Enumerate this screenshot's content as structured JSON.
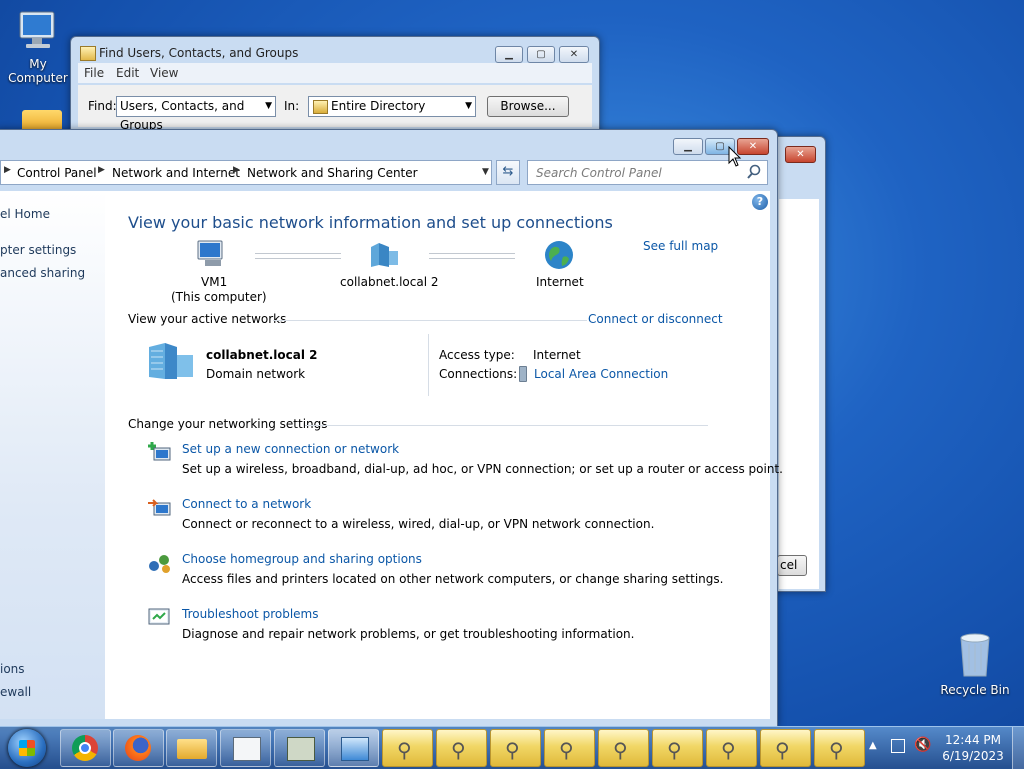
{
  "desktop": {
    "my_computer_label": "My Computer",
    "recycle_bin_label": "Recycle Bin"
  },
  "find_dialog": {
    "title": "Find Users, Contacts, and Groups",
    "menu": [
      "File",
      "Edit",
      "View"
    ],
    "find_label": "Find:",
    "find_value": "Users, Contacts, and Groups",
    "in_label": "In:",
    "in_value": "Entire Directory",
    "browse_label": "Browse..."
  },
  "background_dialog": {
    "cancel_partial": "cel"
  },
  "network_center": {
    "breadcrumbs": [
      "Control Panel",
      "Network and Internet",
      "Network and Sharing Center"
    ],
    "search_placeholder": "Search Control Panel",
    "left_links": [
      "el Home",
      "pter settings",
      "anced sharing",
      "ions",
      "ewall"
    ],
    "heading": "View your basic network information and set up connections",
    "see_full_map": "See full map",
    "map": {
      "computer_name": "VM1",
      "computer_sub": "(This computer)",
      "network_name": "collabnet.local  2",
      "internet": "Internet"
    },
    "active_networks_label": "View your active networks",
    "connect_disconnect": "Connect or disconnect",
    "active_network": {
      "name": "collabnet.local  2",
      "type": "Domain network",
      "access_type_label": "Access type:",
      "access_type_value": "Internet",
      "connections_label": "Connections:",
      "connections_value": "Local Area Connection"
    },
    "change_settings_label": "Change your networking settings",
    "tasks": [
      {
        "title": "Set up a new connection or network",
        "desc": "Set up a wireless, broadband, dial-up, ad hoc, or VPN connection; or set up a router or access point."
      },
      {
        "title": "Connect to a network",
        "desc": "Connect or reconnect to a wireless, wired, dial-up, or VPN network connection."
      },
      {
        "title": "Choose homegroup and sharing options",
        "desc": "Access files and printers located on other network computers, or change sharing settings."
      },
      {
        "title": "Troubleshoot problems",
        "desc": "Diagnose and repair network problems, or get troubleshooting information."
      }
    ]
  },
  "tray": {
    "time": "12:44 PM",
    "date": "6/19/2023"
  }
}
